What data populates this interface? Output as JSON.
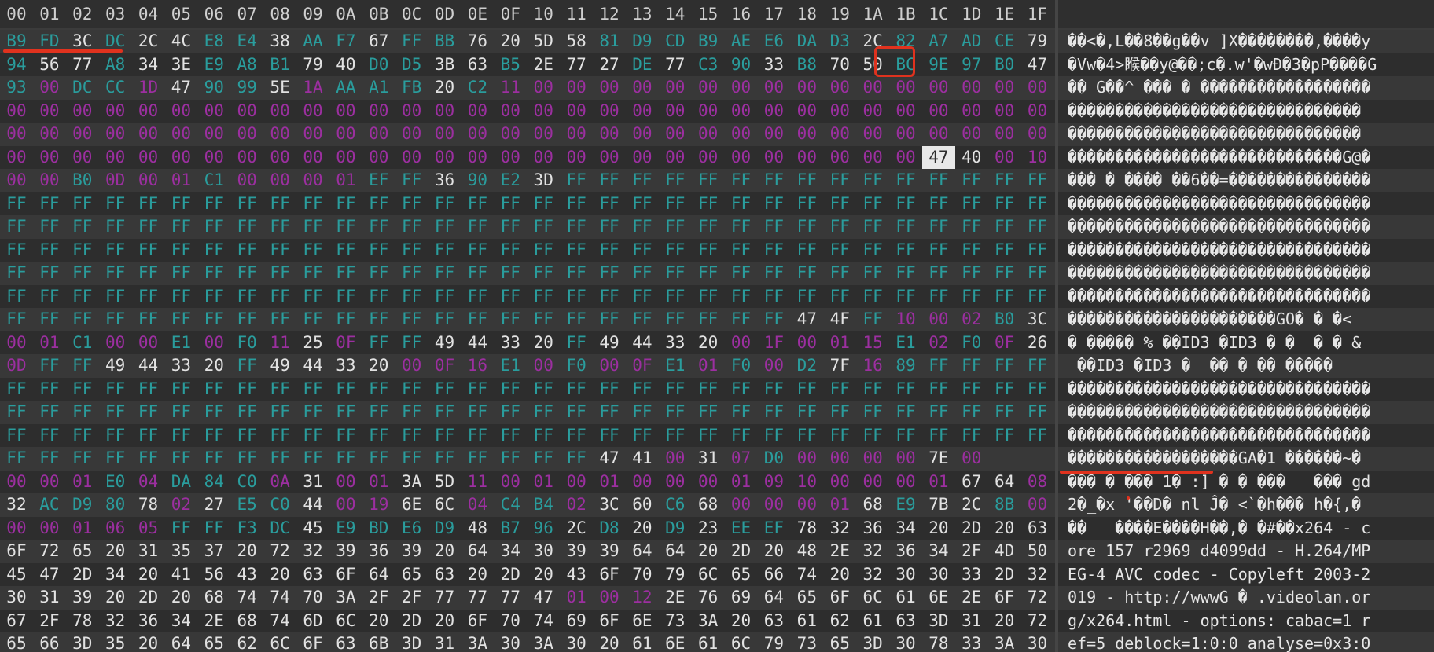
{
  "hex_header": [
    "00",
    "01",
    "02",
    "03",
    "04",
    "05",
    "06",
    "07",
    "08",
    "09",
    "0A",
    "0B",
    "0C",
    "0D",
    "0E",
    "0F",
    "10",
    "11",
    "12",
    "13",
    "14",
    "15",
    "16",
    "17",
    "18",
    "19",
    "1A",
    "1B",
    "1C",
    "1D",
    "1E",
    "1F"
  ],
  "hex_rows": [
    "B9 FD 3C DC 2C 4C E8 E4 38 AA F7 67 FF BB 76 20 5D 58 81 D9 CD B9 AE E6 DA D3 2C 82 A7 AD CE 79",
    "94 56 77 A8 34 3E E9 A8 B1 79 40 D0 D5 3B 63 B5 2E 77 27 DE 77 C3 90 33 B8 70 50 BC 9E 97 B0 47",
    "93 00 DC CC 1D 47 90 99 5E 1A AA A1 FB 20 C2 11 00 00 00 00 00 00 00 00 00 00 00 00 00 00 00 00",
    "00 00 00 00 00 00 00 00 00 00 00 00 00 00 00 00 00 00 00 00 00 00 00 00 00 00 00 00 00 00 00 00",
    "00 00 00 00 00 00 00 00 00 00 00 00 00 00 00 00 00 00 00 00 00 00 00 00 00 00 00 00 00 00 00 00",
    "00 00 00 00 00 00 00 00 00 00 00 00 00 00 00 00 00 00 00 00 00 00 00 00 00 00 00 00 47 40 00 10",
    "00 00 B0 0D 00 01 C1 00 00 00 01 EF FF 36 90 E2 3D FF FF FF FF FF FF FF FF FF FF FF FF FF FF FF",
    "FF FF FF FF FF FF FF FF FF FF FF FF FF FF FF FF FF FF FF FF FF FF FF FF FF FF FF FF FF FF FF FF",
    "FF FF FF FF FF FF FF FF FF FF FF FF FF FF FF FF FF FF FF FF FF FF FF FF FF FF FF FF FF FF FF FF",
    "FF FF FF FF FF FF FF FF FF FF FF FF FF FF FF FF FF FF FF FF FF FF FF FF FF FF FF FF FF FF FF FF",
    "FF FF FF FF FF FF FF FF FF FF FF FF FF FF FF FF FF FF FF FF FF FF FF FF FF FF FF FF FF FF FF FF",
    "FF FF FF FF FF FF FF FF FF FF FF FF FF FF FF FF FF FF FF FF FF FF FF FF FF FF FF FF FF FF FF FF",
    "FF FF FF FF FF FF FF FF FF FF FF FF FF FF FF FF FF FF FF FF FF FF FF FF 47 4F FF 10 00 02 B0 3C",
    "00 01 C1 00 00 E1 00 F0 11 25 0F FF FF 49 44 33 20 FF 49 44 33 20 00 1F 00 01 15 E1 02 F0 0F 26",
    "0D FF FF 49 44 33 20 FF 49 44 33 20 00 0F 16 E1 00 F0 00 0F E1 01 F0 00 D2 7F 16 89 FF FF FF FF",
    "FF FF FF FF FF FF FF FF FF FF FF FF FF FF FF FF FF FF FF FF FF FF FF FF FF FF FF FF FF FF FF FF",
    "FF FF FF FF FF FF FF FF FF FF FF FF FF FF FF FF FF FF FF FF FF FF FF FF FF FF FF FF FF FF FF FF",
    "FF FF FF FF FF FF FF FF FF FF FF FF FF FF FF FF FF FF FF FF FF FF FF FF FF FF FF FF FF FF FF FF",
    "FF FF FF FF FF FF FF FF FF FF FF FF FF FF FF FF FF FF 47 41 00 31 07 D0 00 00 00 00 7E 00",
    "00 00 01 E0 04 DA 84 C0 0A 31 00 01 3A 5D 11 00 01 00 01 00 00 00 01 09 10 00 00 00 01 67 64 08",
    "32 AC D9 80 78 02 27 E5 C0 44 00 19 6E 6C 04 C4 B4 02 3C 60 C6 68 00 00 00 01 68 E9 7B 2C 8B 00",
    "00 00 01 06 05 FF FF F3 DC 45 E9 BD E6 D9 48 B7 96 2C D8 20 D9 23 EE EF 78 32 36 34 20 2D 20 63",
    "6F 72 65 20 31 35 37 20 72 32 39 36 39 20 64 34 30 39 39 64 64 20 2D 20 48 2E 32 36 34 2F 4D 50",
    "45 47 2D 34 20 41 56 43 20 63 6F 64 65 63 20 2D 20 43 6F 70 79 6C 65 66 74 20 32 30 30 33 2D 32",
    "30 31 39 20 2D 20 68 74 74 70 3A 2F 2F 77 77 77 47 01 00 12 2E 76 69 64 65 6F 6C 61 6E 2E 6F 72",
    "67 2F 78 32 36 34 2E 68 74 6D 6C 20 2D 20 6F 70 74 69 6F 6E 73 3A 20 63 61 62 61 63 3D 31 20 72",
    "65 66 3D 35 20 64 65 62 6C 6F 63 6B 3D 31 3A 30 3A 30 20 61 6E 61 6C 79 73 65 3D 30 78 33 3A 30"
  ],
  "ascii_rows": [
    "��<�,L��8��g��v ]X��������,����y",
    "�Vw�4>睺��y@��;c�.w'�wĐ�3�pP����G",
    "�� G��^ ��� � ������������������",
    "�������������������������������",
    "�������������������������������",
    "�����������������������������G@�",
    "��� � ���� ��6��=���������������",
    "��������������������������������",
    "��������������������������������",
    "��������������������������������",
    "��������������������������������",
    "��������������������������������",
    "����������������������GO� � �<",
    "� ����� % ��ID3 �ID3 � �  � � &",
    " ��ID3 �ID3 �  �� � �� �����",
    "��������������������������������",
    "��������������������������������",
    "��������������������������������",
    "������������������GA�1 ������~�",
    "��� � ��� 1� :] � � ���   ��� gd",
    "2�_�x '��D� nl Ĵ� <`�h��� h�{,�",
    "��   ����E����H��,� �#��x264 - c",
    "ore 157 r2969 d4099dd - H.264/MP",
    "EG-4 AVC codec - Copyleft 2003-2",
    "019 - http://wwwG � .videolan.or",
    "g/x264.html - options: cabac=1 r",
    "ef=5 deblock=1:0:0 analyse=0x3:0"
  ],
  "colors": {
    "zero_byte": "#9c2fa0",
    "high_byte": "#2a9d9d",
    "text_byte": "#e2e2e2",
    "annotation": "#e0321e"
  }
}
